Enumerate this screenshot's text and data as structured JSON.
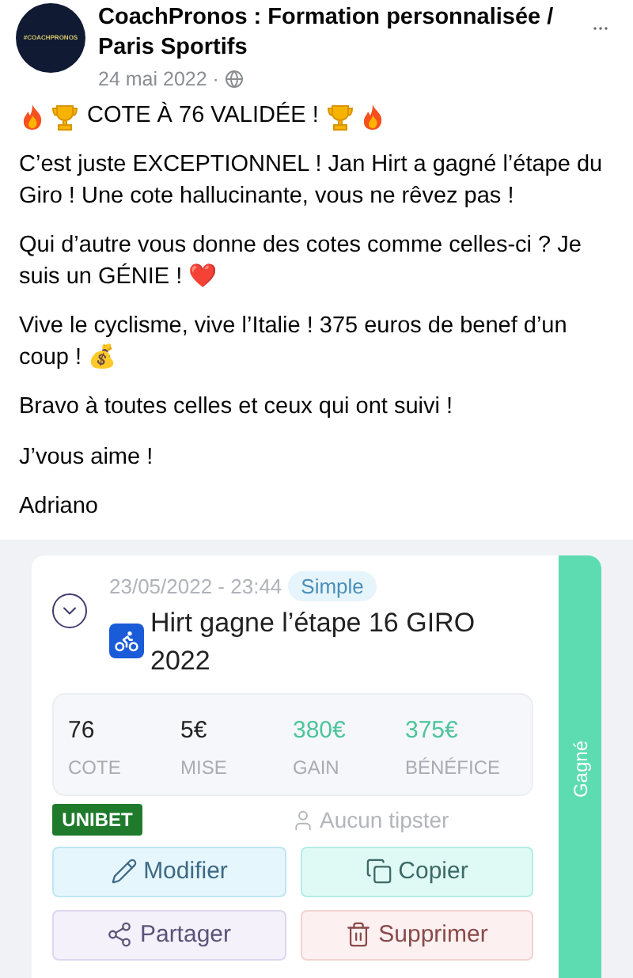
{
  "post": {
    "page_name": "CoachPronos : Formation personnalisée / Paris Sportifs",
    "avatar_text": "#COACHPRONOS",
    "date": "24 mai 2022 ·",
    "headline": "COTE À 76 VALIDÉE !",
    "paragraphs": [
      "C’est juste EXCEPTIONNEL ! Jan Hirt a gagné l’étape du Giro ! Une cote hallucinante, vous ne rêvez pas !",
      "Qui d’autre vous donne des cotes comme celles-ci ? Je suis un GÉNIE ! ❤️",
      "Vive le cyclisme, vive l’Italie ! 375 euros de benef d’un coup ! 💰",
      "Bravo à toutes celles et ceux qui ont suivi !",
      "J’vous aime !",
      "Adriano"
    ]
  },
  "bet": {
    "datetime": "23/05/2022 - 23:44",
    "type_badge": "Simple",
    "title": "Hirt gagne l’étape 16 GIRO 2022",
    "stats": [
      {
        "value": "76",
        "label": "COTE",
        "highlight": false
      },
      {
        "value": "5€",
        "label": "MISE",
        "highlight": false
      },
      {
        "value": "380€",
        "label": "GAIN",
        "highlight": true
      },
      {
        "value": "375€",
        "label": "BÉNÉFICE",
        "highlight": true
      }
    ],
    "bookmaker": "UNIBET",
    "tipster": "Aucun tipster",
    "actions": [
      {
        "label": "Modifier",
        "kind": "edit"
      },
      {
        "label": "Copier",
        "kind": "copy"
      },
      {
        "label": "Partager",
        "kind": "share"
      },
      {
        "label": "Supprimer",
        "kind": "delete"
      }
    ],
    "status": "Gagné"
  }
}
